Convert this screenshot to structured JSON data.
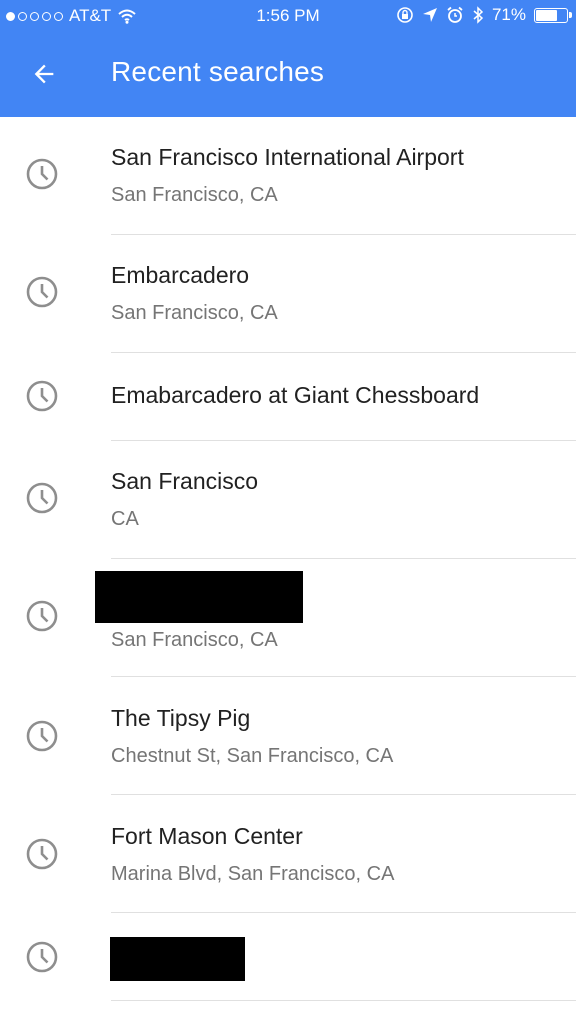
{
  "status_bar": {
    "carrier": "AT&T",
    "time": "1:56 PM",
    "battery": "71%",
    "battery_level": 0.71,
    "signal_bars_filled": 1,
    "signal_bars_total": 5,
    "icons": [
      "wifi-icon",
      "rotation-lock-icon",
      "location-arrow-icon",
      "alarm-icon",
      "bluetooth-icon",
      "battery-icon"
    ]
  },
  "app_bar": {
    "title": "Recent searches",
    "back_icon": "arrow-back-icon",
    "color": "#4285f4"
  },
  "items": [
    {
      "primary": "San Francisco International Airport",
      "secondary": "San Francisco, CA",
      "icon": "history-clock-icon"
    },
    {
      "primary": "Embarcadero",
      "secondary": "San Francisco, CA",
      "icon": "history-clock-icon"
    },
    {
      "primary": "Emabarcadero at Giant Chessboard",
      "secondary": "",
      "icon": "history-clock-icon"
    },
    {
      "primary": "San Francisco",
      "secondary": "CA",
      "icon": "history-clock-icon"
    },
    {
      "primary": "",
      "secondary": "San Francisco, CA",
      "icon": "history-clock-icon",
      "redacted": true
    },
    {
      "primary": "The Tipsy Pig",
      "secondary": "Chestnut St, San Francisco, CA",
      "icon": "history-clock-icon"
    },
    {
      "primary": "Fort Mason Center",
      "secondary": "Marina Blvd, San Francisco, CA",
      "icon": "history-clock-icon"
    },
    {
      "primary": "",
      "secondary": "",
      "icon": "history-clock-icon",
      "redacted": true
    }
  ]
}
